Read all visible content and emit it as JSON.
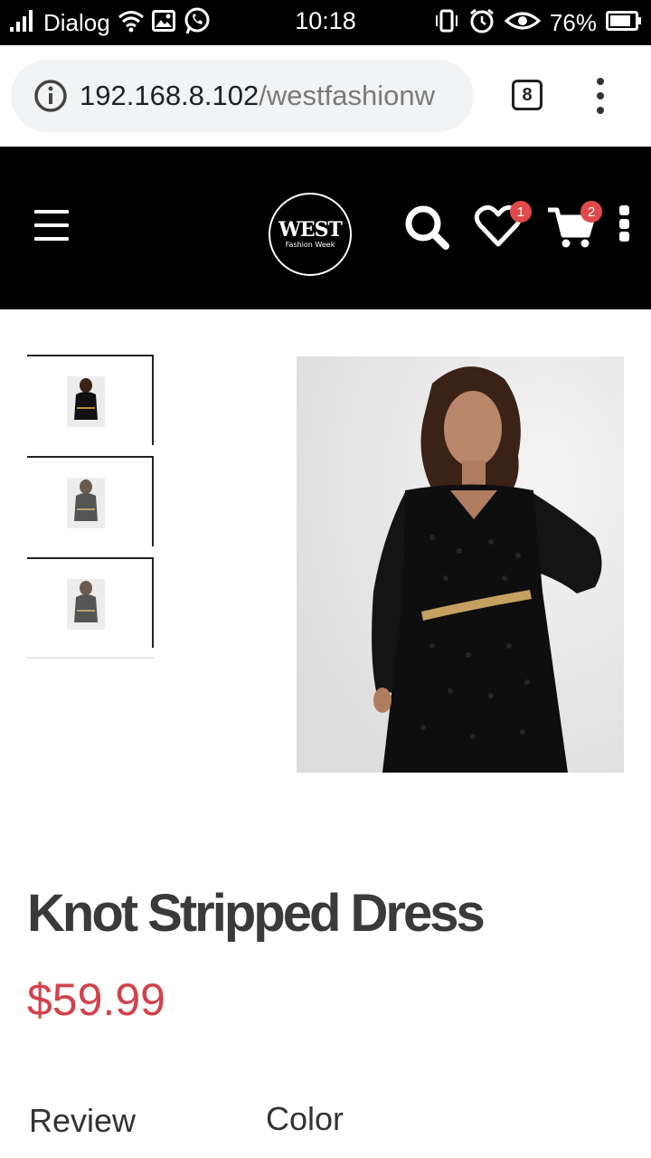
{
  "status_bar": {
    "carrier": "Dialog",
    "time": "10:18",
    "battery": "76%"
  },
  "browser": {
    "url_host": "192.168.8.102",
    "url_path": "/westfashionw",
    "tab_count": "8"
  },
  "header": {
    "logo_main": "WEST",
    "logo_sub": "Fashion Week",
    "wishlist_count": "1",
    "cart_count": "2"
  },
  "product": {
    "title": "Knot Stripped Dress",
    "price": "$59.99"
  },
  "tabs": {
    "review": "Review",
    "color": "Color"
  },
  "colors": {
    "accent_red": "#d2424c",
    "badge_red": "#e04a4a",
    "header_bg": "#000000"
  }
}
